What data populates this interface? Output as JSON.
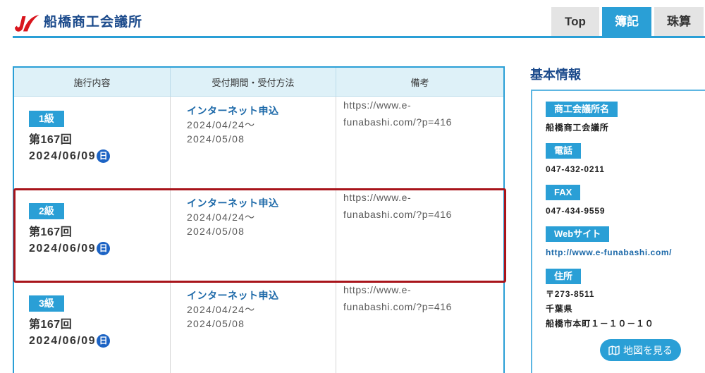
{
  "colors": {
    "accent": "#2a9fd6",
    "brand_red": "#d9141c",
    "navy": "#1c4b8c",
    "link": "#1b68a8",
    "weekday_badge": "#1c63c4",
    "highlight": "#a8141b",
    "table_header_bg": "#def1f8",
    "tab_inactive_bg": "#e4e4e4"
  },
  "header": {
    "logo_icon": "red-swoosh-logo",
    "site_name": "船橋商工会議所",
    "tabs": [
      {
        "label": "Top",
        "active": false
      },
      {
        "label": "簿記",
        "active": true
      },
      {
        "label": "珠算",
        "active": false
      }
    ]
  },
  "exam_table": {
    "columns": [
      "施行内容",
      "受付期間・受付方法",
      "備考"
    ],
    "rows": [
      {
        "grade": "1級",
        "session": "第167回",
        "date": "2024/06/09",
        "weekday": "日",
        "method": "インターネット申込",
        "period_start": "2024/04/24～",
        "period_end": "2024/05/08",
        "note": "https://www.e-funabashi.com/?p=416"
      },
      {
        "grade": "2級",
        "session": "第167回",
        "date": "2024/06/09",
        "weekday": "日",
        "method": "インターネット申込",
        "period_start": "2024/04/24～",
        "period_end": "2024/05/08",
        "note": "https://www.e-funabashi.com/?p=416"
      },
      {
        "grade": "3級",
        "session": "第167回",
        "date": "2024/06/09",
        "weekday": "日",
        "method": "インターネット申込",
        "period_start": "2024/04/24～",
        "period_end": "2024/05/08",
        "note": "https://www.e-funabashi.com/?p=416"
      }
    ]
  },
  "sidebar": {
    "title": "基本情報",
    "items": [
      {
        "label": "商工会議所名",
        "value": "船橋商工会議所"
      },
      {
        "label": "電話",
        "value": "047-432-0211"
      },
      {
        "label": "FAX",
        "value": "047-434-9559"
      },
      {
        "label": "Webサイト",
        "value": "http://www.e-funabashi.com/"
      },
      {
        "label": "住所",
        "value_lines": [
          "〒273-8511",
          "千葉県",
          "船橋市本町１－１０－１０"
        ]
      }
    ],
    "map_button": {
      "label": "地図を見る",
      "icon": "map-icon"
    }
  }
}
